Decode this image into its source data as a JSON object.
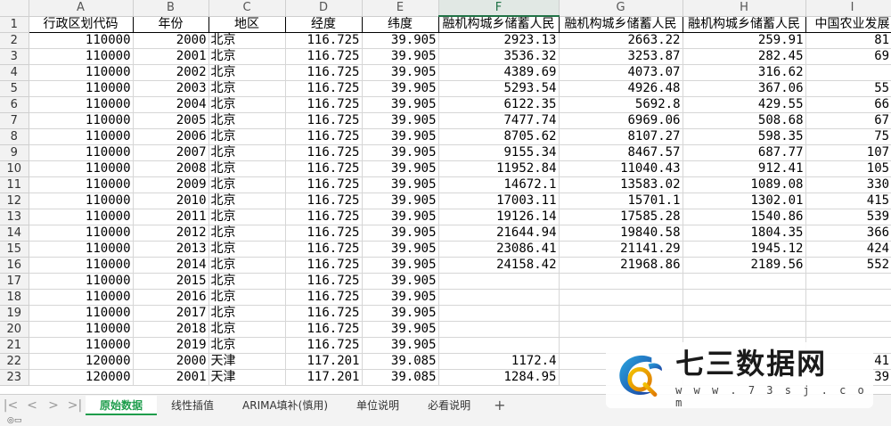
{
  "columns": [
    "A",
    "B",
    "C",
    "D",
    "E",
    "F",
    "G",
    "H",
    "I"
  ],
  "selected_column": "F",
  "header_row": [
    "行政区划代码",
    "年份",
    "地区",
    "经度",
    "纬度",
    "融机构城乡储蓄人民",
    "融机构城乡储蓄人民",
    "融机构城乡储蓄人民",
    "中国农业发展"
  ],
  "rows": [
    [
      "110000",
      "2000",
      "北京",
      "116.725",
      "39.905",
      "2923.13",
      "2663.22",
      "259.91",
      "81."
    ],
    [
      "110000",
      "2001",
      "北京",
      "116.725",
      "39.905",
      "3536.32",
      "3253.87",
      "282.45",
      "69."
    ],
    [
      "110000",
      "2002",
      "北京",
      "116.725",
      "39.905",
      "4389.69",
      "4073.07",
      "316.62",
      ""
    ],
    [
      "110000",
      "2003",
      "北京",
      "116.725",
      "39.905",
      "5293.54",
      "4926.48",
      "367.06",
      "55."
    ],
    [
      "110000",
      "2004",
      "北京",
      "116.725",
      "39.905",
      "6122.35",
      "5692.8",
      "429.55",
      "66."
    ],
    [
      "110000",
      "2005",
      "北京",
      "116.725",
      "39.905",
      "7477.74",
      "6969.06",
      "508.68",
      "67."
    ],
    [
      "110000",
      "2006",
      "北京",
      "116.725",
      "39.905",
      "8705.62",
      "8107.27",
      "598.35",
      "75."
    ],
    [
      "110000",
      "2007",
      "北京",
      "116.725",
      "39.905",
      "9155.34",
      "8467.57",
      "687.77",
      "107."
    ],
    [
      "110000",
      "2008",
      "北京",
      "116.725",
      "39.905",
      "11952.84",
      "11040.43",
      "912.41",
      "105."
    ],
    [
      "110000",
      "2009",
      "北京",
      "116.725",
      "39.905",
      "14672.1",
      "13583.02",
      "1089.08",
      "330."
    ],
    [
      "110000",
      "2010",
      "北京",
      "116.725",
      "39.905",
      "17003.11",
      "15701.1",
      "1302.01",
      "415."
    ],
    [
      "110000",
      "2011",
      "北京",
      "116.725",
      "39.905",
      "19126.14",
      "17585.28",
      "1540.86",
      "539."
    ],
    [
      "110000",
      "2012",
      "北京",
      "116.725",
      "39.905",
      "21644.94",
      "19840.58",
      "1804.35",
      "366."
    ],
    [
      "110000",
      "2013",
      "北京",
      "116.725",
      "39.905",
      "23086.41",
      "21141.29",
      "1945.12",
      "424."
    ],
    [
      "110000",
      "2014",
      "北京",
      "116.725",
      "39.905",
      "24158.42",
      "21968.86",
      "2189.56",
      "552."
    ],
    [
      "110000",
      "2015",
      "北京",
      "116.725",
      "39.905",
      "",
      "",
      "",
      ""
    ],
    [
      "110000",
      "2016",
      "北京",
      "116.725",
      "39.905",
      "",
      "",
      "",
      ""
    ],
    [
      "110000",
      "2017",
      "北京",
      "116.725",
      "39.905",
      "",
      "",
      "",
      ""
    ],
    [
      "110000",
      "2018",
      "北京",
      "116.725",
      "39.905",
      "",
      "",
      "",
      ""
    ],
    [
      "110000",
      "2019",
      "北京",
      "116.725",
      "39.905",
      "",
      "",
      "",
      ""
    ],
    [
      "120000",
      "2000",
      "天津",
      "117.201",
      "39.085",
      "1172.4",
      "",
      "",
      "41."
    ],
    [
      "120000",
      "2001",
      "天津",
      "117.201",
      "39.085",
      "1284.95",
      "",
      "",
      "39."
    ]
  ],
  "sheet_tabs": [
    "原始数据",
    "线性插值",
    "ARIMA填补(慎用)",
    "单位说明",
    "必看说明"
  ],
  "active_tab": 0,
  "watermark": {
    "title": "七三数据网",
    "url": "w w w . 7 3 s j . c o m"
  },
  "accent_color": "#217346",
  "tab_active_color": "#1e9d4c"
}
